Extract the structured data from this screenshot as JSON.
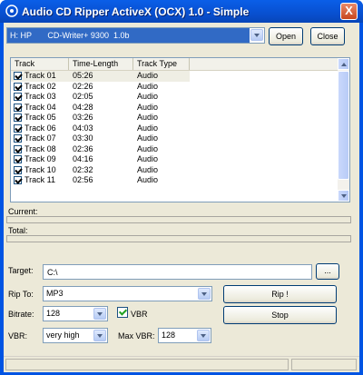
{
  "window": {
    "title": "Audio CD Ripper ActiveX (OCX) 1.0 - Simple",
    "close_glyph": "X",
    "icon": "audio-cd-app-icon"
  },
  "drive": {
    "selected": "H: HP       CD-Writer+ 9300  1.0b",
    "open_label": "Open",
    "close_label": "Close"
  },
  "tracks": {
    "columns": [
      "Track",
      "Time-Length",
      "Track Type"
    ],
    "rows": [
      {
        "track": "Track 01",
        "time": "05:26",
        "type": "Audio",
        "checked": true
      },
      {
        "track": "Track 02",
        "time": "02:26",
        "type": "Audio",
        "checked": true
      },
      {
        "track": "Track 03",
        "time": "02:05",
        "type": "Audio",
        "checked": true
      },
      {
        "track": "Track 04",
        "time": "04:28",
        "type": "Audio",
        "checked": true
      },
      {
        "track": "Track 05",
        "time": "03:26",
        "type": "Audio",
        "checked": true
      },
      {
        "track": "Track 06",
        "time": "04:03",
        "type": "Audio",
        "checked": true
      },
      {
        "track": "Track 07",
        "time": "03:30",
        "type": "Audio",
        "checked": true
      },
      {
        "track": "Track 08",
        "time": "02:36",
        "type": "Audio",
        "checked": true
      },
      {
        "track": "Track 09",
        "time": "04:16",
        "type": "Audio",
        "checked": true
      },
      {
        "track": "Track 10",
        "time": "02:32",
        "type": "Audio",
        "checked": true
      },
      {
        "track": "Track 11",
        "time": "02:56",
        "type": "Audio",
        "checked": true
      }
    ]
  },
  "progress": {
    "current_label": "Current:",
    "total_label": "Total:",
    "current_value": 0,
    "total_value": 0
  },
  "target": {
    "label": "Target:",
    "value": "C:\\",
    "browse_label": "..."
  },
  "rip_to": {
    "label": "Rip To:",
    "value": "MP3",
    "rip_label": "Rip !"
  },
  "bitrate": {
    "label": "Bitrate:",
    "value": "128",
    "vbr_label": "VBR",
    "vbr_checked": true,
    "stop_label": "Stop"
  },
  "vbr": {
    "label": "VBR:",
    "value": "very high",
    "max_label": "Max VBR:",
    "max_value": "128"
  },
  "colors": {
    "titlebar": "#0054e3",
    "selection": "#316ac5",
    "dialog_bg": "#ece9d8",
    "close_button": "#c8461e"
  }
}
